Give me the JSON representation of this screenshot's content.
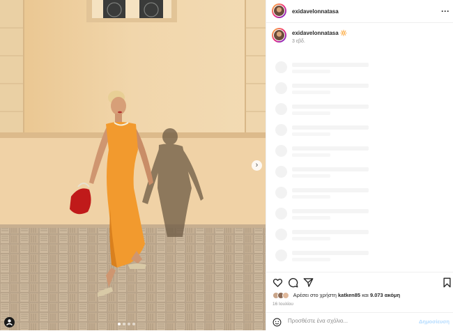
{
  "header": {
    "username": "exidavelonnatasa"
  },
  "caption": {
    "username": "exidavelonnatasa",
    "emoji": "🔆",
    "time": "3 εβδ."
  },
  "icons": {
    "more": "more-options-icon",
    "like": "heart-icon",
    "comment": "comment-icon",
    "share": "share-icon",
    "save": "bookmark-icon",
    "emoji": "emoji-icon",
    "next": "chevron-right-icon",
    "tagged": "user-tag-icon"
  },
  "likes": {
    "prefix": "Αρέσει στο χρήστη",
    "user": "katken85",
    "middle": "και",
    "count": "9.073 ακόμη"
  },
  "date": "16 Ιουλίου",
  "comment": {
    "placeholder": "Προσθέστε ένα σχόλιο...",
    "post_label": "Δημοσίευση"
  },
  "colors": {
    "dress": "#f29a2e",
    "bag": "#c01a1a",
    "wall": "#efd3a7",
    "link": "#0095f6"
  },
  "carousel": {
    "slides": 4,
    "active": 1
  }
}
